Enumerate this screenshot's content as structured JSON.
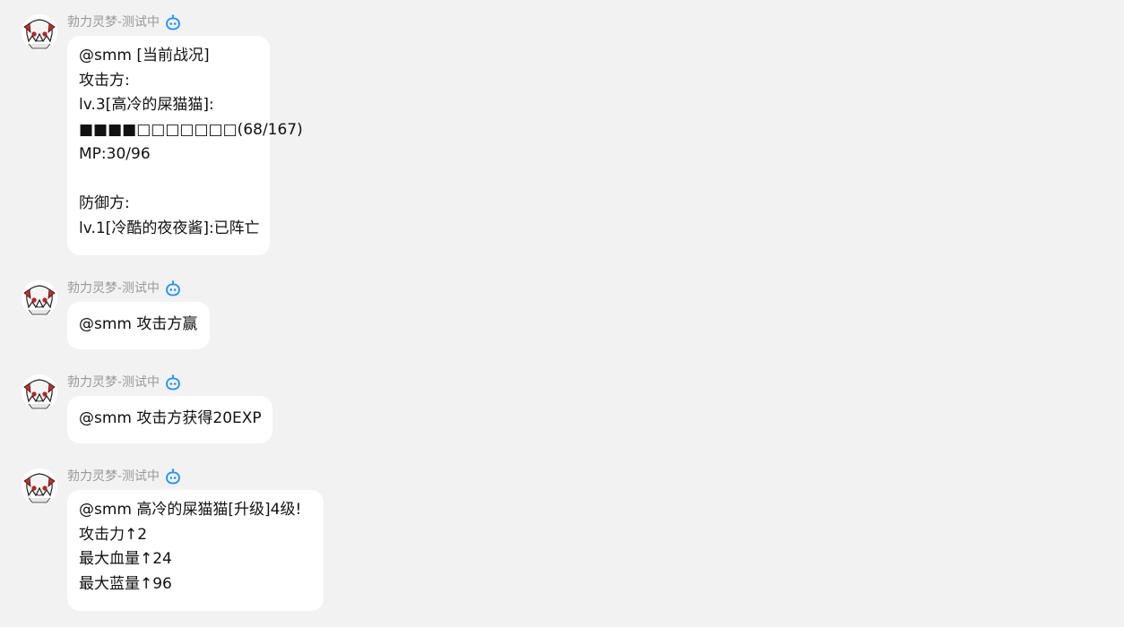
{
  "messages": [
    {
      "sender": "勃力灵梦-测试中",
      "lines": [
        "@smm [当前战况]",
        "攻击方:",
        "lv.3[高冷的屎猫猫]:",
        "■■■■□□□□□□□(68/167)",
        "MP:30/96",
        "",
        "防御方:",
        "lv.1[冷酷的夜夜酱]:已阵亡"
      ]
    },
    {
      "sender": "勃力灵梦-测试中",
      "lines": [
        "@smm 攻击方赢"
      ]
    },
    {
      "sender": "勃力灵梦-测试中",
      "lines": [
        "@smm 攻击方获得20EXP"
      ]
    },
    {
      "sender": "勃力灵梦-测试中",
      "lines": [
        "@smm 高冷的屎猫猫[升级]4级!",
        "攻击力↑2",
        "最大血量↑24",
        "最大蓝量↑96"
      ]
    }
  ],
  "icons": {
    "avatar": "anime-avatar-icon",
    "bot": "robot-icon"
  },
  "colors": {
    "background": "#f2f2f2",
    "bubble": "#ffffff",
    "sender_name": "#999999",
    "bot_icon": "#1e90ff",
    "text": "#111111"
  }
}
